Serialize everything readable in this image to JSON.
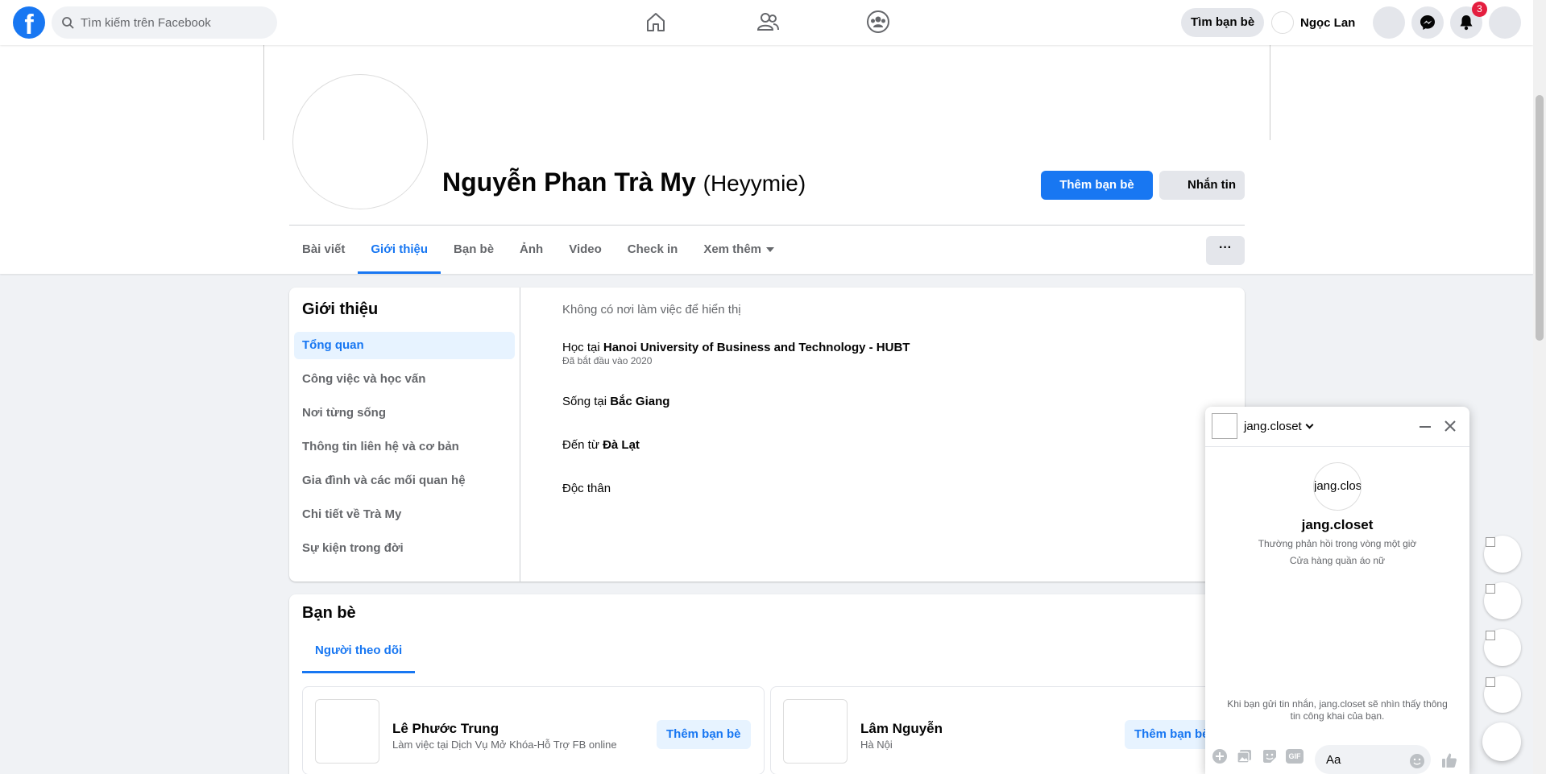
{
  "colors": {
    "primary": "#1877f2",
    "badge": "#e41e3f",
    "muted": "#65676b"
  },
  "topbar": {
    "logo_text": "f",
    "search_placeholder": "Tìm kiếm trên Facebook",
    "find_friends_label": "Tìm bạn bè",
    "user_name": "Ngọc Lan",
    "notification_count": "3",
    "nav_icons": [
      "home-icon",
      "friends-icon",
      "groups-icon"
    ]
  },
  "profile": {
    "name": "Nguyễn Phan Trà My",
    "alt_name": "(Heyymie)",
    "add_friend_label": "Thêm bạn bè",
    "message_label": "Nhắn tin",
    "tabs": [
      "Bài viết",
      "Giới thiệu",
      "Bạn bè",
      "Ảnh",
      "Video",
      "Check in",
      "Xem thêm"
    ],
    "active_tab": "Giới thiệu",
    "more_label": "···"
  },
  "about": {
    "title": "Giới thiệu",
    "nav": [
      "Tổng quan",
      "Công việc và học vấn",
      "Nơi từng sống",
      "Thông tin liên hệ và cơ bản",
      "Gia đình và các mối quan hệ",
      "Chi tiết về Trà My",
      "Sự kiện trong đời"
    ],
    "no_work": "Không có nơi làm việc để hiển thị",
    "study_prefix": "Học tại",
    "study_school": "Hanoi University of Business and Technology - HUBT",
    "study_since": "Đã bắt đầu vào 2020",
    "lives_prefix": "Sống tại",
    "lives_place": "Bắc Giang",
    "from_prefix": "Đến từ",
    "from_place": "Đà Lạt",
    "relationship": "Độc thân"
  },
  "friends": {
    "title": "Bạn bè",
    "tab_label": "Người theo dõi",
    "items": [
      {
        "name": "Lê Phước Trung",
        "sub": "Làm việc tại Dịch Vụ Mở Khóa-Hỗ Trợ FB online",
        "button": "Thêm bạn bè"
      },
      {
        "name": "Lâm Nguyễn",
        "sub": "Hà Nội",
        "button": "Thêm bạn bè"
      }
    ]
  },
  "chat": {
    "name": "jang.closet",
    "avatar_text": "jang.clos",
    "title": "jang.closet",
    "response": "Thường phản hồi trong vòng một giờ",
    "category": "Cửa hàng quần áo nữ",
    "note": "Khi bạn gửi tin nhắn, jang.closet sẽ nhìn thấy thông tin công khai của bạn.",
    "input_placeholder": "Aa",
    "gif_label": "GIF"
  }
}
